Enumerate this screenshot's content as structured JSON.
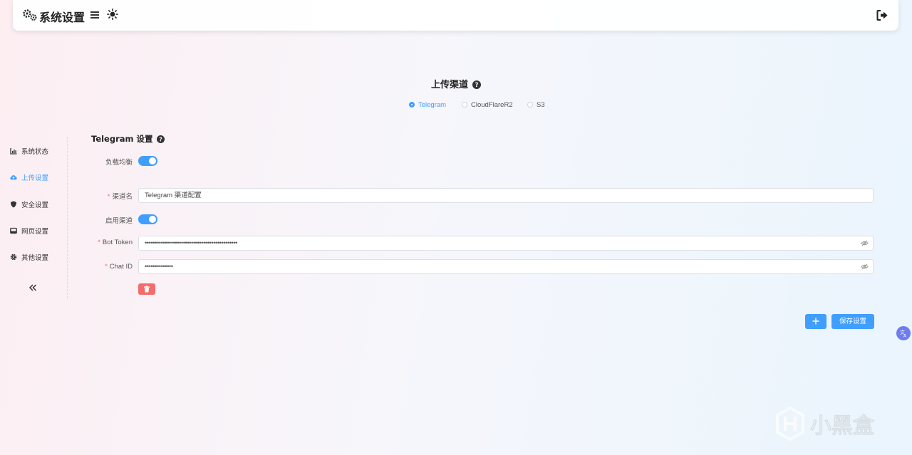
{
  "header": {
    "title": "系统设置"
  },
  "upload": {
    "title": "上传渠道",
    "channels": [
      {
        "label": "Telegram",
        "selected": true
      },
      {
        "label": "CloudFlareR2",
        "selected": false
      },
      {
        "label": "S3",
        "selected": false
      }
    ]
  },
  "sidebar": {
    "items": [
      {
        "label": "系统状态",
        "icon": "bar-chart-icon",
        "active": false
      },
      {
        "label": "上传设置",
        "icon": "cloud-upload-icon",
        "active": true
      },
      {
        "label": "安全设置",
        "icon": "shield-icon",
        "active": false
      },
      {
        "label": "网页设置",
        "icon": "window-icon",
        "active": false
      },
      {
        "label": "其他设置",
        "icon": "gear-icon",
        "active": false
      }
    ]
  },
  "form": {
    "title": "Telegram 设置",
    "load_balance_label": "负载均衡",
    "load_balance_on": true,
    "channel_name_label": "渠道名",
    "channel_name_value": "Telegram 渠道配置",
    "enable_label": "启用渠道",
    "enable_on": true,
    "bot_token_label": "Bot Token",
    "bot_token_value": "••••••••••••••••••••••••••••••••••••••••••••••",
    "chat_id_label": "Chat ID",
    "chat_id_value": "••••••••••••••",
    "required_mark": "*"
  },
  "actions": {
    "save_label": "保存设置"
  },
  "watermark": {
    "text": "小黑盒"
  },
  "colors": {
    "accent": "#409eff",
    "danger": "#f56c6c"
  }
}
